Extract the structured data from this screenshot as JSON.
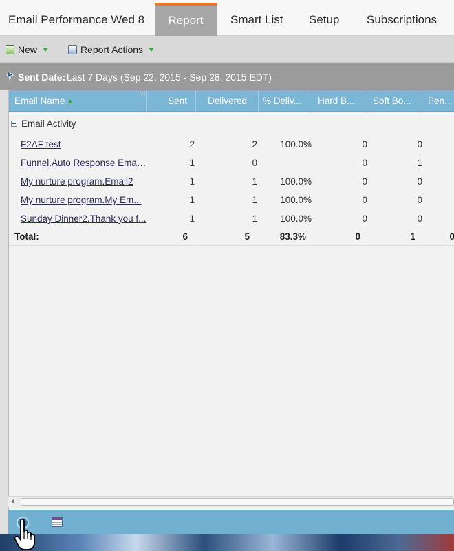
{
  "tabs": [
    {
      "label": "Email Performance Wed 8",
      "active": false
    },
    {
      "label": "Report",
      "active": true
    },
    {
      "label": "Smart List",
      "active": false
    },
    {
      "label": "Setup",
      "active": false
    },
    {
      "label": "Subscriptions",
      "active": false
    }
  ],
  "toolbar": {
    "new_label": "New",
    "actions_label": "Report Actions"
  },
  "filter": {
    "label": "Sent Date:",
    "value": "Last 7 Days (Sep 22, 2015 - Sep 28, 2015 EDT)"
  },
  "table": {
    "columns": [
      "Email Name",
      "Sent",
      "Delivered",
      "% Deliv...",
      "Hard B...",
      "Soft Bo...",
      "Pen..."
    ],
    "group_label": "Email Activity",
    "rows": [
      {
        "name": "F2AF test",
        "sent": "2",
        "delivered": "2",
        "pct": "100.0%",
        "hard": "0",
        "soft": "0"
      },
      {
        "name": "Funnel.Auto Response Email...",
        "sent": "1",
        "delivered": "0",
        "pct": "",
        "hard": "0",
        "soft": "1"
      },
      {
        "name": "My nurture program.Email2",
        "sent": "1",
        "delivered": "1",
        "pct": "100.0%",
        "hard": "0",
        "soft": "0"
      },
      {
        "name": "My nurture program.My Em...",
        "sent": "1",
        "delivered": "1",
        "pct": "100.0%",
        "hard": "0",
        "soft": "0"
      },
      {
        "name": "Sunday Dinner2.Thank you f...",
        "sent": "1",
        "delivered": "1",
        "pct": "100.0%",
        "hard": "0",
        "soft": "0"
      }
    ],
    "total": {
      "label": "Total:",
      "sent": "6",
      "delivered": "5",
      "pct": "83.3%",
      "hard": "0",
      "soft": "1",
      "pen": "0"
    }
  },
  "colors": {
    "active_tab_accent": "#e8772e",
    "header_blue": "#7ab7d6",
    "bottom_bar": "#72b0d2"
  }
}
